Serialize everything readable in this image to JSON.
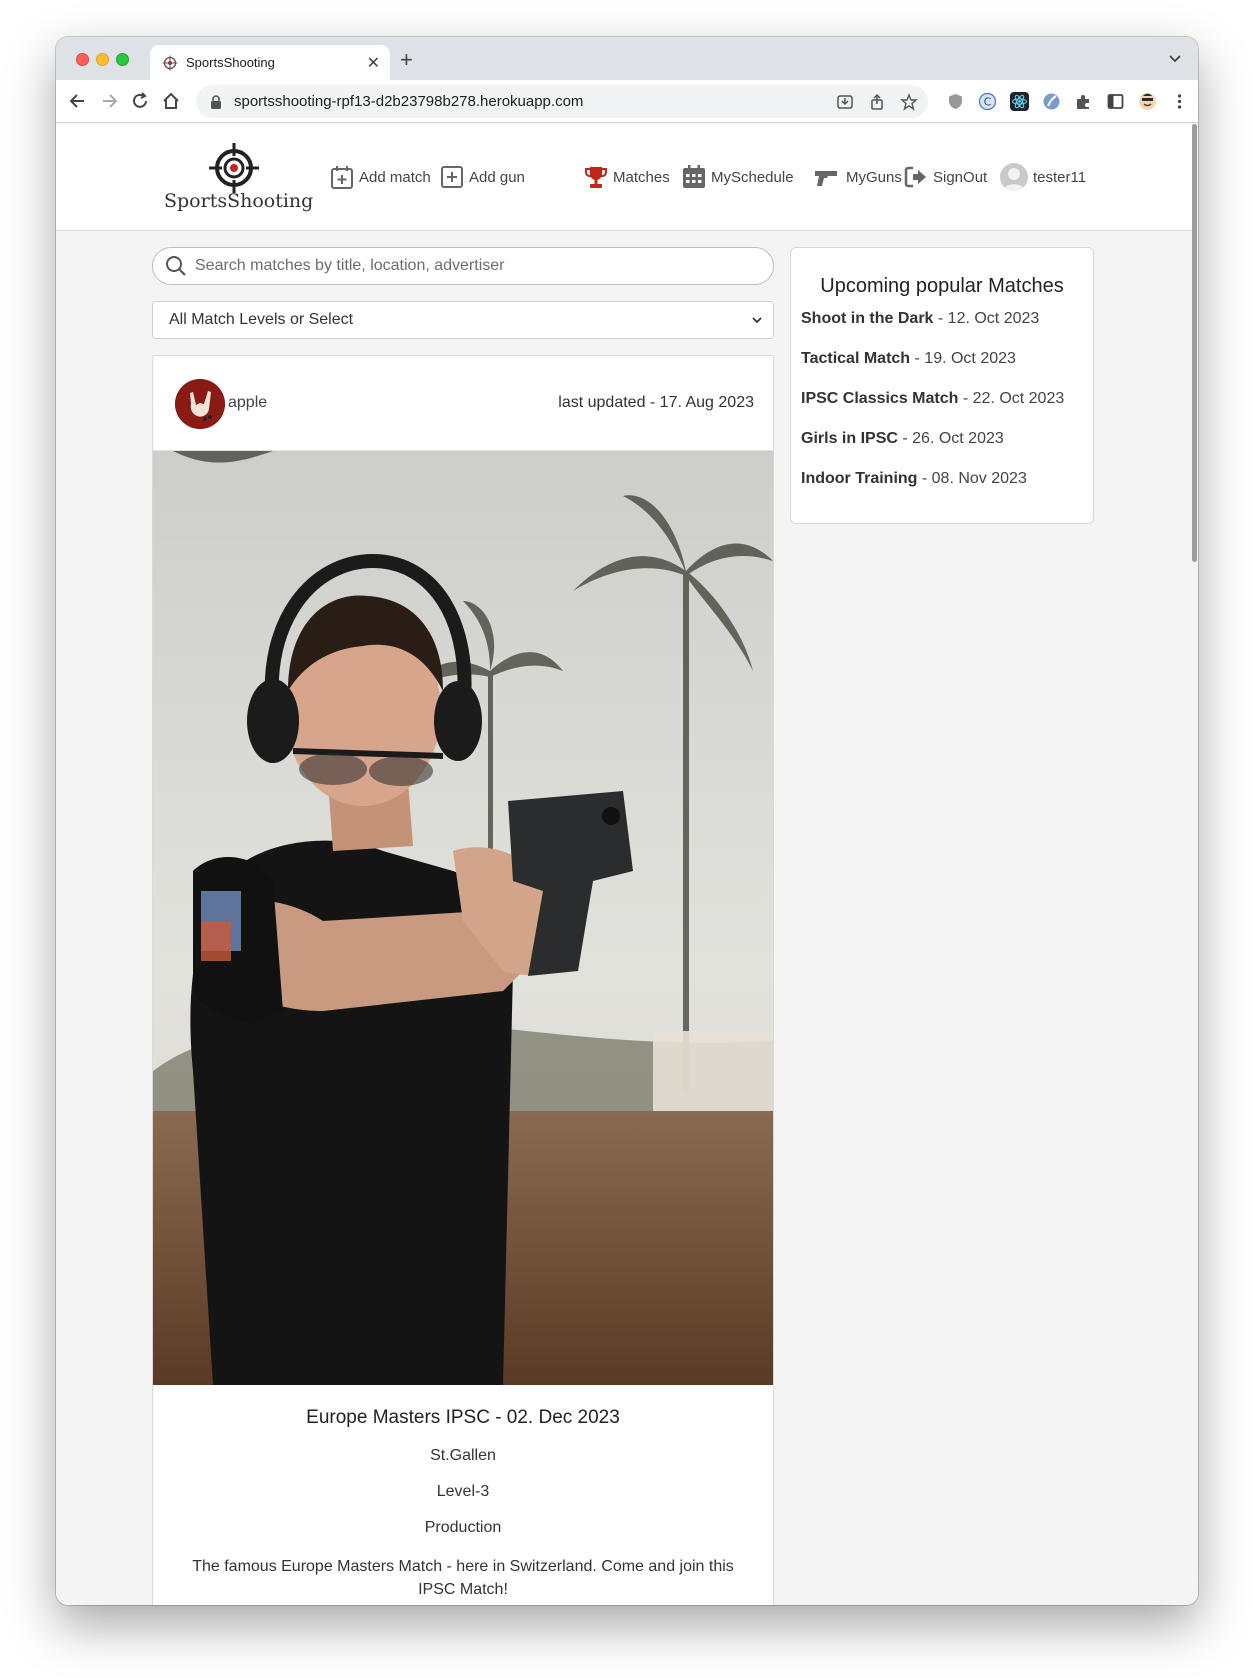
{
  "browser": {
    "tab_title": "SportsShooting",
    "url": "sportsshooting-rpf13-d2b23798b278.herokuapp.com"
  },
  "site": {
    "brand": "SportsShooting",
    "nav": {
      "add_match": "Add match",
      "add_gun": "Add gun",
      "matches": "Matches",
      "myschedule": "MySchedule",
      "myguns": "MyGuns",
      "signout": "SignOut",
      "user": "tester11"
    },
    "accent_color": "#c0261b"
  },
  "search": {
    "placeholder": "Search matches by title, location, advertiser"
  },
  "level_select": {
    "selected": "All Match Levels or Select"
  },
  "match_card": {
    "user": "apple",
    "last_updated": "last updated - 17. Aug 2023",
    "title": "Europe Masters IPSC - 02. Dec 2023",
    "location": "St.Gallen",
    "level": "Level-3",
    "division": "Production",
    "description": "The famous Europe Masters Match - here in Switzerland. Come and join this IPSC Match!"
  },
  "sidebar": {
    "heading": "Upcoming popular Matches",
    "items": [
      {
        "name": "Shoot in the Dark",
        "date": " - 12. Oct 2023"
      },
      {
        "name": "Tactical Match",
        "date": " - 19. Oct 2023"
      },
      {
        "name": "IPSC Classics Match",
        "date": " - 22. Oct 2023"
      },
      {
        "name": "Girls in IPSC",
        "date": " - 26. Oct 2023"
      },
      {
        "name": "Indoor Training",
        "date": " - 08. Nov 2023"
      }
    ]
  }
}
